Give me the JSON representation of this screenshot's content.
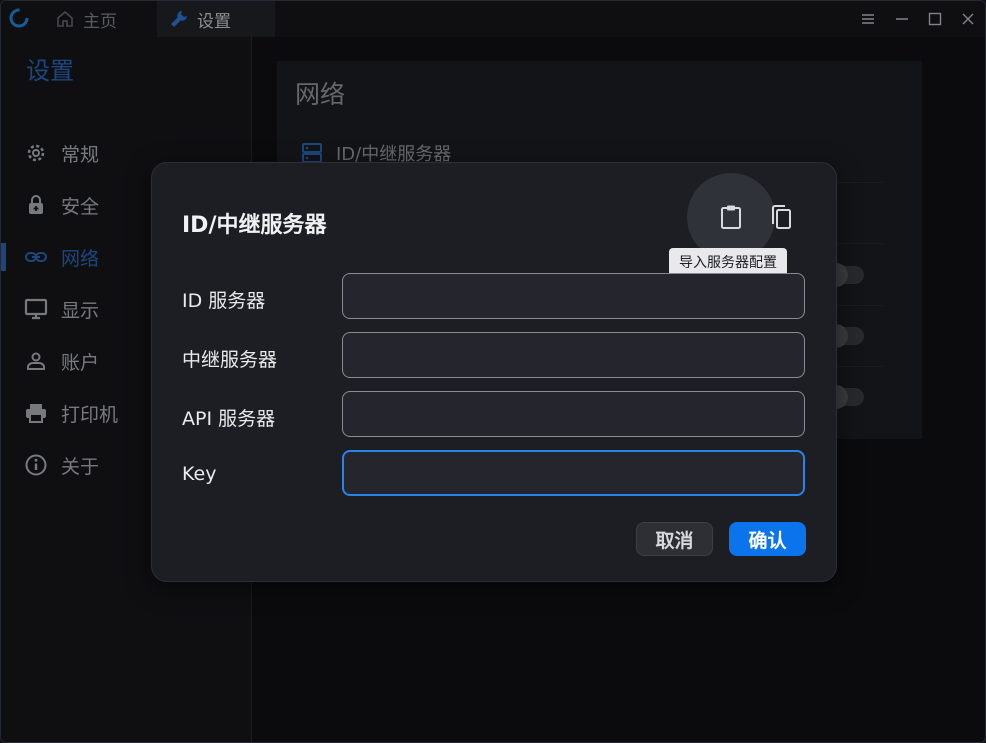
{
  "titlebar": {
    "tabs": [
      {
        "label": "主页",
        "icon": "home-icon"
      },
      {
        "label": "设置",
        "icon": "wrench-icon"
      }
    ],
    "controls": [
      "menu-icon",
      "minimize-icon",
      "maximize-icon",
      "close-icon"
    ]
  },
  "sidebar": {
    "title": "设置",
    "items": [
      {
        "label": "常规",
        "icon": "gear-icon"
      },
      {
        "label": "安全",
        "icon": "lock-icon"
      },
      {
        "label": "网络",
        "icon": "link-icon",
        "active": true
      },
      {
        "label": "显示",
        "icon": "monitor-icon"
      },
      {
        "label": "账户",
        "icon": "person-icon"
      },
      {
        "label": "打印机",
        "icon": "printer-icon"
      },
      {
        "label": "关于",
        "icon": "info-icon"
      }
    ]
  },
  "main": {
    "card_title": "网络",
    "row_label": "ID/中继服务器"
  },
  "dialog": {
    "title": "ID/中继服务器",
    "tooltip": "导入服务器配置",
    "fields": [
      {
        "label": "ID 服务器",
        "value": ""
      },
      {
        "label": "中继服务器",
        "value": ""
      },
      {
        "label": "API 服务器",
        "value": ""
      },
      {
        "label": "Key",
        "value": ""
      }
    ],
    "cancel_label": "取消",
    "ok_label": "确认"
  },
  "colors": {
    "accent": "#2b6ec2",
    "primary_button": "#0b73ec",
    "focus_border": "#2a83e6"
  }
}
